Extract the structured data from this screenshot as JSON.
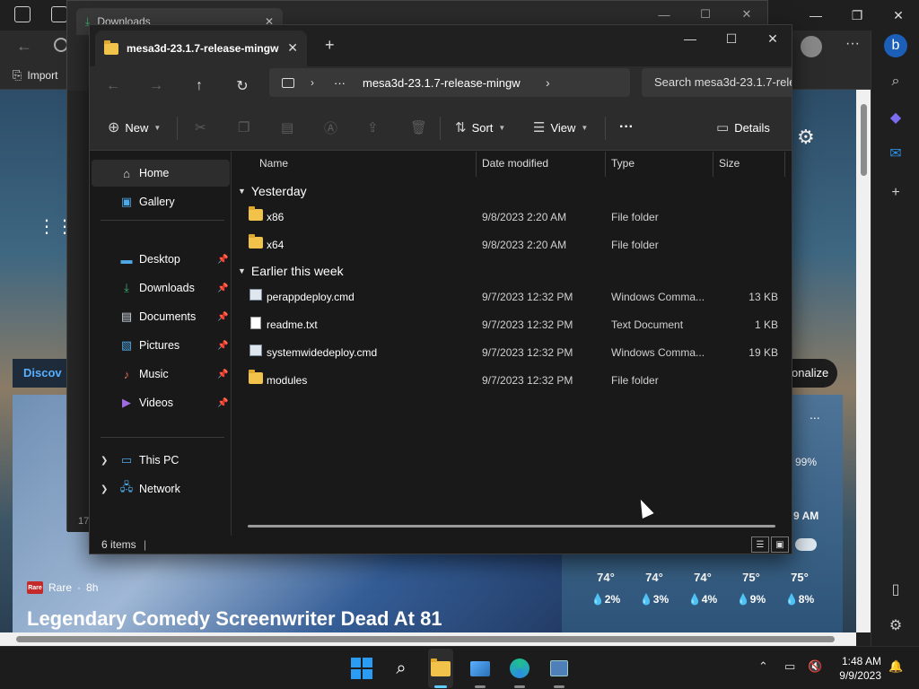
{
  "browser": {
    "tab_downloads": "Downloads",
    "favorites_import": "Import",
    "discover_tab": "Discov",
    "personalize_btn": "onalize",
    "sidebar_count": "17",
    "news": {
      "source": "Rare",
      "time": "8h",
      "headline": "Legendary Comedy Screenwriter Dead At 81",
      "more": "..."
    },
    "weather": {
      "percent": "99%",
      "time_label": "9 AM",
      "hours": [
        {
          "temp": "74°",
          "rain": "2%"
        },
        {
          "temp": "74°",
          "rain": "3%"
        },
        {
          "temp": "74°",
          "rain": "4%"
        },
        {
          "temp": "75°",
          "rain": "9%"
        },
        {
          "temp": "75°",
          "rain": "8%"
        }
      ]
    }
  },
  "explorer": {
    "tab_title": "mesa3d-23.1.7-release-mingw",
    "address": {
      "overflow": "···",
      "current": "mesa3d-23.1.7-release-mingw"
    },
    "search_placeholder": "Search mesa3d-23.1.7-rele",
    "commands": {
      "new": "New",
      "sort": "Sort",
      "view": "View",
      "more": "···",
      "details": "Details"
    },
    "nav": {
      "home": "Home",
      "gallery": "Gallery",
      "desktop": "Desktop",
      "downloads": "Downloads",
      "documents": "Documents",
      "pictures": "Pictures",
      "music": "Music",
      "videos": "Videos",
      "this_pc": "This PC",
      "network": "Network"
    },
    "columns": {
      "name": "Name",
      "date": "Date modified",
      "type": "Type",
      "size": "Size"
    },
    "groups": [
      {
        "label": "Yesterday",
        "files": [
          {
            "name": "x86",
            "date": "9/8/2023 2:20 AM",
            "type": "File folder",
            "size": "",
            "icon": "folder"
          },
          {
            "name": "x64",
            "date": "9/8/2023 2:20 AM",
            "type": "File folder",
            "size": "",
            "icon": "folder"
          }
        ]
      },
      {
        "label": "Earlier this week",
        "files": [
          {
            "name": "perappdeploy.cmd",
            "date": "9/7/2023 12:32 PM",
            "type": "Windows Comma...",
            "size": "13 KB",
            "icon": "cmd"
          },
          {
            "name": "readme.txt",
            "date": "9/7/2023 12:32 PM",
            "type": "Text Document",
            "size": "1 KB",
            "icon": "doc"
          },
          {
            "name": "systemwidedeploy.cmd",
            "date": "9/7/2023 12:32 PM",
            "type": "Windows Comma...",
            "size": "19 KB",
            "icon": "cmd"
          },
          {
            "name": "modules",
            "date": "9/7/2023 12:32 PM",
            "type": "File folder",
            "size": "",
            "icon": "folder"
          }
        ]
      }
    ],
    "status": "6 items"
  },
  "taskbar": {
    "time": "1:48 AM",
    "date": "9/9/2023"
  },
  "colors": {
    "accent": "#60cdff",
    "folder": "#f1c34b",
    "windows_blue": "#2b9cf4"
  }
}
